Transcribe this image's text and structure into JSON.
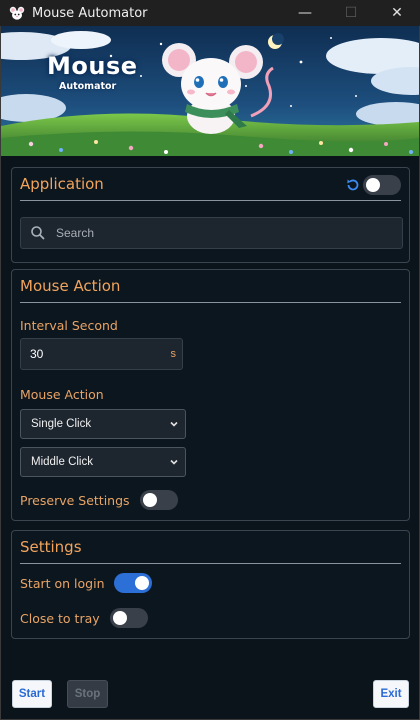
{
  "window": {
    "title": "Mouse Automator",
    "minimize_glyph": "—",
    "maximize_glyph": "☐",
    "close_glyph": "✕"
  },
  "banner": {
    "brand_title": "Mouse",
    "brand_subtitle": "Automator"
  },
  "application": {
    "title": "Application",
    "toggle_on": false,
    "search_placeholder": "Search",
    "search_value": ""
  },
  "mouse_action": {
    "title": "Mouse Action",
    "interval_label": "Interval Second",
    "interval_value": "30",
    "interval_unit": "s",
    "action_label": "Mouse Action",
    "click_type": "Single Click",
    "button_type": "Middle Click",
    "preserve_label": "Preserve Settings",
    "preserve_on": false
  },
  "settings": {
    "title": "Settings",
    "start_on_login_label": "Start on login",
    "start_on_login_on": true,
    "close_to_tray_label": "Close to tray",
    "close_to_tray_on": false
  },
  "footer": {
    "start_label": "Start",
    "stop_label": "Stop",
    "exit_label": "Exit"
  },
  "colors": {
    "accent_orange": "#f2a45c",
    "toggle_on_blue": "#2c6fd6",
    "background": "#0b141b"
  }
}
